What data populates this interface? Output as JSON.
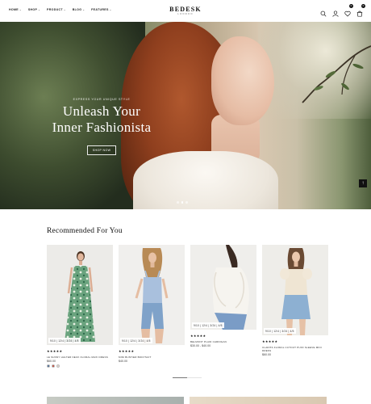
{
  "header": {
    "nav": [
      {
        "label": "HOME"
      },
      {
        "label": "SHOP"
      },
      {
        "label": "PRODUCT"
      },
      {
        "label": "BLOG"
      },
      {
        "label": "FEATURES"
      }
    ],
    "logo": "BEDESK",
    "logo_sub": "LONDON",
    "icons": [
      "search-icon",
      "user-icon",
      "wishlist-icon",
      "cart-icon"
    ],
    "wishlist_count": "0",
    "cart_count": "0"
  },
  "hero": {
    "eyebrow": "EXPRESS YOUR UNIQUE STYLE",
    "title_line1": "Unleash Your",
    "title_line2": "Inner Fashionista",
    "button": "SHOP NOW",
    "slides": 3,
    "active_slide": 1
  },
  "section": {
    "title": "Recommended For You"
  },
  "products": [
    {
      "sizes": "9/10 | 12/4 | 3/24 | 4/5",
      "stars": "★★★★★",
      "name": "LE SUNNY HALTER NECK FLORAL MAXI DRESS",
      "price": "$60.00",
      "swatches": [
        "#3b5f8e",
        "#c23a2a",
        "#e8d8d0"
      ]
    },
    {
      "sizes": "9/10 | 12/4 | 3/24 | 4/5",
      "stars": "★★★★★",
      "name": "MINI BUSTIER BODYSUIT",
      "price": "$40.00",
      "swatches": []
    },
    {
      "sizes": "9/10 | 12/4 | 3/24 | 4/5",
      "stars": "★★★★★",
      "name": "BELMONT PLAID CARDIGAN",
      "price": "$30.00 - $40.00",
      "swatches": []
    },
    {
      "sizes": "9/10 | 12/4 | 3/24 | 4/5",
      "stars": "★★★★★",
      "name": "CLARITA FLORAL CUTOUT PUFF SLEEVE MINI DRESS",
      "price": "$60.00",
      "swatches": []
    }
  ]
}
